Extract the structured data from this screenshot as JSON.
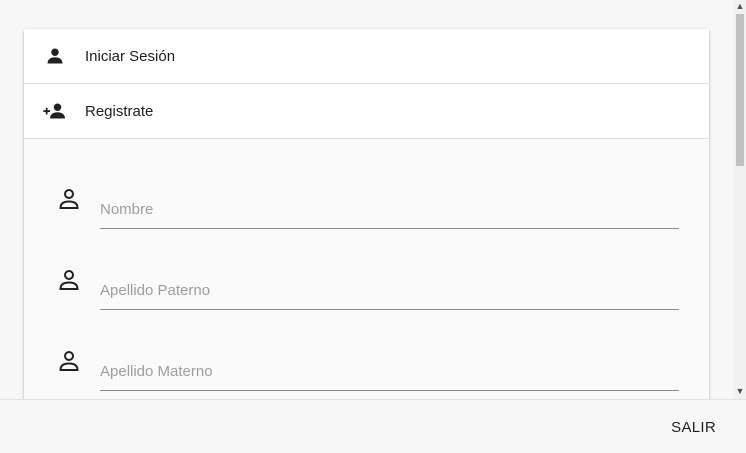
{
  "tabs": [
    {
      "label": "Iniciar Sesión",
      "icon": "person-icon"
    },
    {
      "label": "Registrate",
      "icon": "person-add-icon"
    }
  ],
  "form": {
    "fields": [
      {
        "placeholder": "Nombre",
        "value": "",
        "icon": "person-outline-icon"
      },
      {
        "placeholder": "Apellido Paterno",
        "value": "",
        "icon": "person-outline-icon"
      },
      {
        "placeholder": "Apellido Materno",
        "value": "",
        "icon": "person-outline-icon"
      }
    ]
  },
  "footer": {
    "exit_label": "SALIR"
  },
  "colors": {
    "background": "#f7f7f7",
    "text": "#212121",
    "placeholder": "#9e9e9e",
    "underline": "#8a8a8a"
  }
}
